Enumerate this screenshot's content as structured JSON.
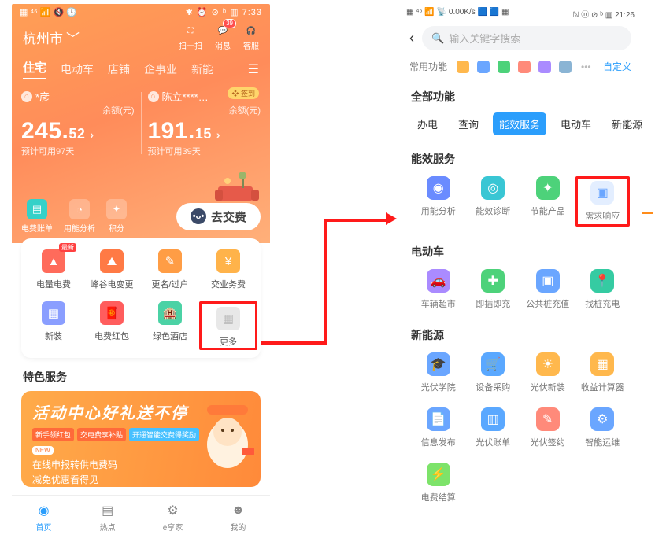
{
  "phone1": {
    "status_left": "▦ ⁴⁶ 📶 🔇 🕓",
    "status_right": "✱ ⏰ ⊘ ᵇ ▥ 7:33",
    "location": "杭州市",
    "top_icons": [
      {
        "label": "扫一扫",
        "ic": "⛶"
      },
      {
        "label": "消息",
        "ic": "💬",
        "badge": true
      },
      {
        "label": "客服",
        "ic": "🎧"
      }
    ],
    "tabs": [
      "住宅",
      "电动车",
      "店铺",
      "企事业",
      "新能"
    ],
    "accounts": [
      {
        "name": "*彦",
        "bal_label": "余额(元)",
        "int": "245.",
        "dec": "52",
        "est": "预计可用97天"
      },
      {
        "name": "陈立****…",
        "bal_label": "余额(元)",
        "int": "191.",
        "dec": "15",
        "est": "预计可用39天",
        "sign": "签到"
      }
    ],
    "row3": [
      {
        "label": "电费账单",
        "ic": "▤"
      },
      {
        "label": "用能分析",
        "ic": "◔"
      },
      {
        "label": "积分",
        "ic": "✦"
      }
    ],
    "pay_label": "去交费",
    "grid": [
      {
        "label": "电量电费",
        "newtag": "最新",
        "color": "c1",
        "ic": "▲"
      },
      {
        "label": "峰谷电变更",
        "color": "c2",
        "ic": "⛰"
      },
      {
        "label": "更名/过户",
        "color": "c3",
        "ic": "✎"
      },
      {
        "label": "交业务费",
        "color": "c4",
        "ic": "¥"
      },
      {
        "label": "新装",
        "color": "c5",
        "ic": "▦"
      },
      {
        "label": "电费红包",
        "color": "c6",
        "ic": "🧧"
      },
      {
        "label": "绿色酒店",
        "color": "c7",
        "ic": "🏨"
      },
      {
        "label": "更多",
        "color": "more",
        "ic": "▦",
        "highlight": true
      }
    ],
    "special_title": "特色服务",
    "promo": {
      "title": "活动中心好礼送不停",
      "pills": [
        "新手领红包",
        "交电费享补贴",
        "开通智能交费得奖励"
      ],
      "l1": "在线申报转供电费码",
      "l2": "减免优惠看得见",
      "new": "NEW"
    },
    "nav": [
      {
        "label": "首页",
        "ic": "◉",
        "active": true
      },
      {
        "label": "热点",
        "ic": "▤"
      },
      {
        "label": "e享家",
        "ic": "⚙"
      },
      {
        "label": "我的",
        "ic": "☻"
      }
    ]
  },
  "phone2": {
    "status_left": "▦ ⁴⁶ 📶 📡 0.00K/s 🟦 🟦 ▦",
    "status_right": "ℕ ⓝ ⊘ ᵇ ▥ 21:26",
    "search_ph": "输入关键字搜索",
    "fav_label": "常用功能",
    "custom": "自定义",
    "all_label": "全部功能",
    "tabs": [
      "办电",
      "查询",
      "能效服务",
      "电动车",
      "新能源"
    ],
    "tab_active": 2,
    "sections": [
      {
        "title": "能效服务",
        "items": [
          {
            "label": "用能分析",
            "bg": "#6a8bff",
            "ic": "◉"
          },
          {
            "label": "能效诊断",
            "bg": "#39c6d4",
            "ic": "◎"
          },
          {
            "label": "节能产品",
            "bg": "#4dd27a",
            "ic": "✦"
          },
          {
            "label": "需求响应",
            "bg": "#e3eeff",
            "ic": "▣",
            "fg": "#6aa6ff",
            "highlight": true
          }
        ]
      },
      {
        "title": "电动车",
        "items": [
          {
            "label": "车辆超市",
            "bg": "#aa8bff",
            "ic": "🚗"
          },
          {
            "label": "即插即充",
            "bg": "#4dd27a",
            "ic": "✚"
          },
          {
            "label": "公共桩充值",
            "bg": "#6aa6ff",
            "ic": "▣"
          },
          {
            "label": "找桩充电",
            "bg": "#35cba2",
            "ic": "📍"
          }
        ]
      },
      {
        "title": "新能源",
        "items": [
          {
            "label": "光伏学院",
            "bg": "#6aa6ff",
            "ic": "🎓"
          },
          {
            "label": "设备采购",
            "bg": "#5aa8ff",
            "ic": "🛒"
          },
          {
            "label": "光伏新装",
            "bg": "#ffb84d",
            "ic": "☀"
          },
          {
            "label": "收益计算器",
            "bg": "#ffb84d",
            "ic": "▦"
          },
          {
            "label": "信息发布",
            "bg": "#6aa6ff",
            "ic": "📄"
          },
          {
            "label": "光伏账单",
            "bg": "#5aa8ff",
            "ic": "▥"
          },
          {
            "label": "光伏签约",
            "bg": "#ff8a7a",
            "ic": "✎"
          },
          {
            "label": "智能运维",
            "bg": "#6aa6ff",
            "ic": "⚙"
          },
          {
            "label": "电费结算",
            "bg": "#7de36a",
            "ic": "⚡"
          }
        ]
      }
    ]
  }
}
